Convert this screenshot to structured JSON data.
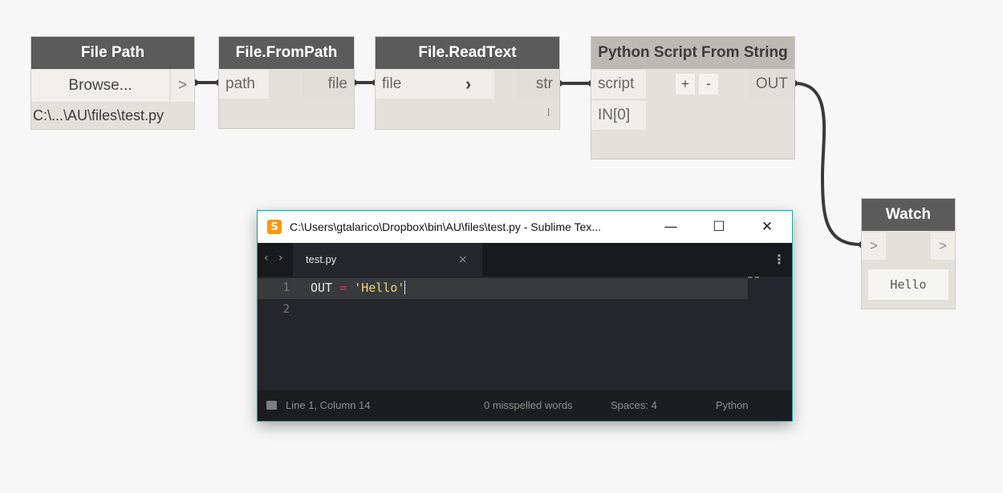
{
  "nodes": {
    "file_path": {
      "title": "File Path",
      "browse_label": "Browse...",
      "output_arrow": ">",
      "path_value": "C:\\...\\AU\\files\\test.py"
    },
    "file_from_path": {
      "title": "File.FromPath",
      "input": "path",
      "output": "file"
    },
    "file_read_text": {
      "title": "File.ReadText",
      "input": "file",
      "arrow": "›",
      "output": "str",
      "lacing": "l"
    },
    "python_script": {
      "title": "Python Script From String",
      "input_script": "script",
      "input_in0": "IN[0]",
      "add_label": "+",
      "remove_label": "-",
      "output": "OUT"
    },
    "watch": {
      "title": "Watch",
      "input_arrow": ">",
      "output_arrow": ">",
      "value": "Hello"
    }
  },
  "sublime": {
    "title": "C:\\Users\\gtalarico\\Dropbox\\bin\\AU\\files\\test.py - Sublime Tex...",
    "app_icon": "sublime-logo-icon",
    "minimize": "—",
    "maximize": "☐",
    "close": "✕",
    "nav_back": "‹",
    "nav_forward": "›",
    "tab_label": "test.py",
    "tab_close": "×",
    "more_menu": "⋮",
    "code": {
      "line1_number": "1",
      "line2_number": "2",
      "line1_var": "OUT",
      "line1_op": "=",
      "line1_str": "'Hello'"
    },
    "status": {
      "position": "Line 1, Column 14",
      "spelling": "0 misspelled words",
      "indent": "Spaces: 4",
      "syntax": "Python"
    }
  },
  "colors": {
    "node_header": "#5b5b5b",
    "node_header_inactive": "#bcbab5",
    "node_body": "#e3e1dc",
    "wire": "#3a3a3a",
    "editor_bg": "#24262b",
    "sublime_accent": "#ff9800",
    "string_token": "#e6db74",
    "operator_token": "#f92672"
  }
}
